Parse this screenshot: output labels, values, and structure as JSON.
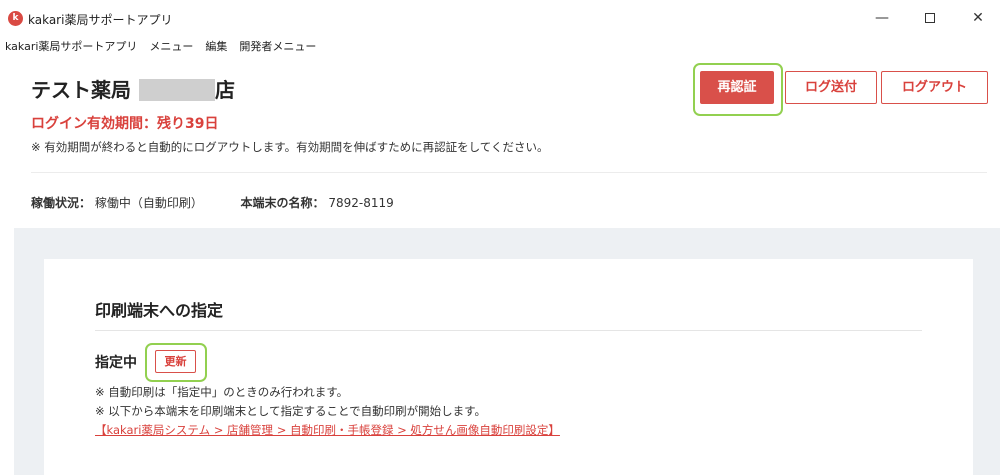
{
  "window": {
    "app_logo_glyph": "k",
    "title": "kakari薬局サポートアプリ",
    "minimize_glyph": "—",
    "close_glyph": "✕"
  },
  "menu": [
    "kakari薬局サポートアプリ",
    "メニュー",
    "編集",
    "開発者メニュー"
  ],
  "header": {
    "pharmacy_prefix": "テスト薬局",
    "pharmacy_suffix": "店",
    "expiry": "ログイン有効期間：残り39日",
    "note": "※ 有効期間が終わると自動的にログアウトします。有効期間を伸ばすために再認証をしてください。"
  },
  "buttons": {
    "reauth": "再認証",
    "send_log": "ログ送付",
    "logout": "ログアウト"
  },
  "status": {
    "label": "稼働状況：",
    "value": "稼働中（自動印刷）",
    "device_label": "本端末の名称：",
    "device_value": "7892-8119"
  },
  "card": {
    "title": "印刷端末への指定",
    "designated_label": "指定中",
    "update_button": "更新",
    "note1": "※ 自動印刷は「指定中」のときのみ行われます。",
    "note2": "※ 以下から本端末を印刷端末として指定することで自動印刷が開始します。",
    "link": "【kakari薬局システム > 店舗管理 > 自動印刷・手帳登録 > 処方せん画像自動印刷設定】"
  },
  "colors": {
    "accent_red": "#d9504a",
    "highlight_green": "#92d050",
    "background_grey": "#edf0f3"
  }
}
